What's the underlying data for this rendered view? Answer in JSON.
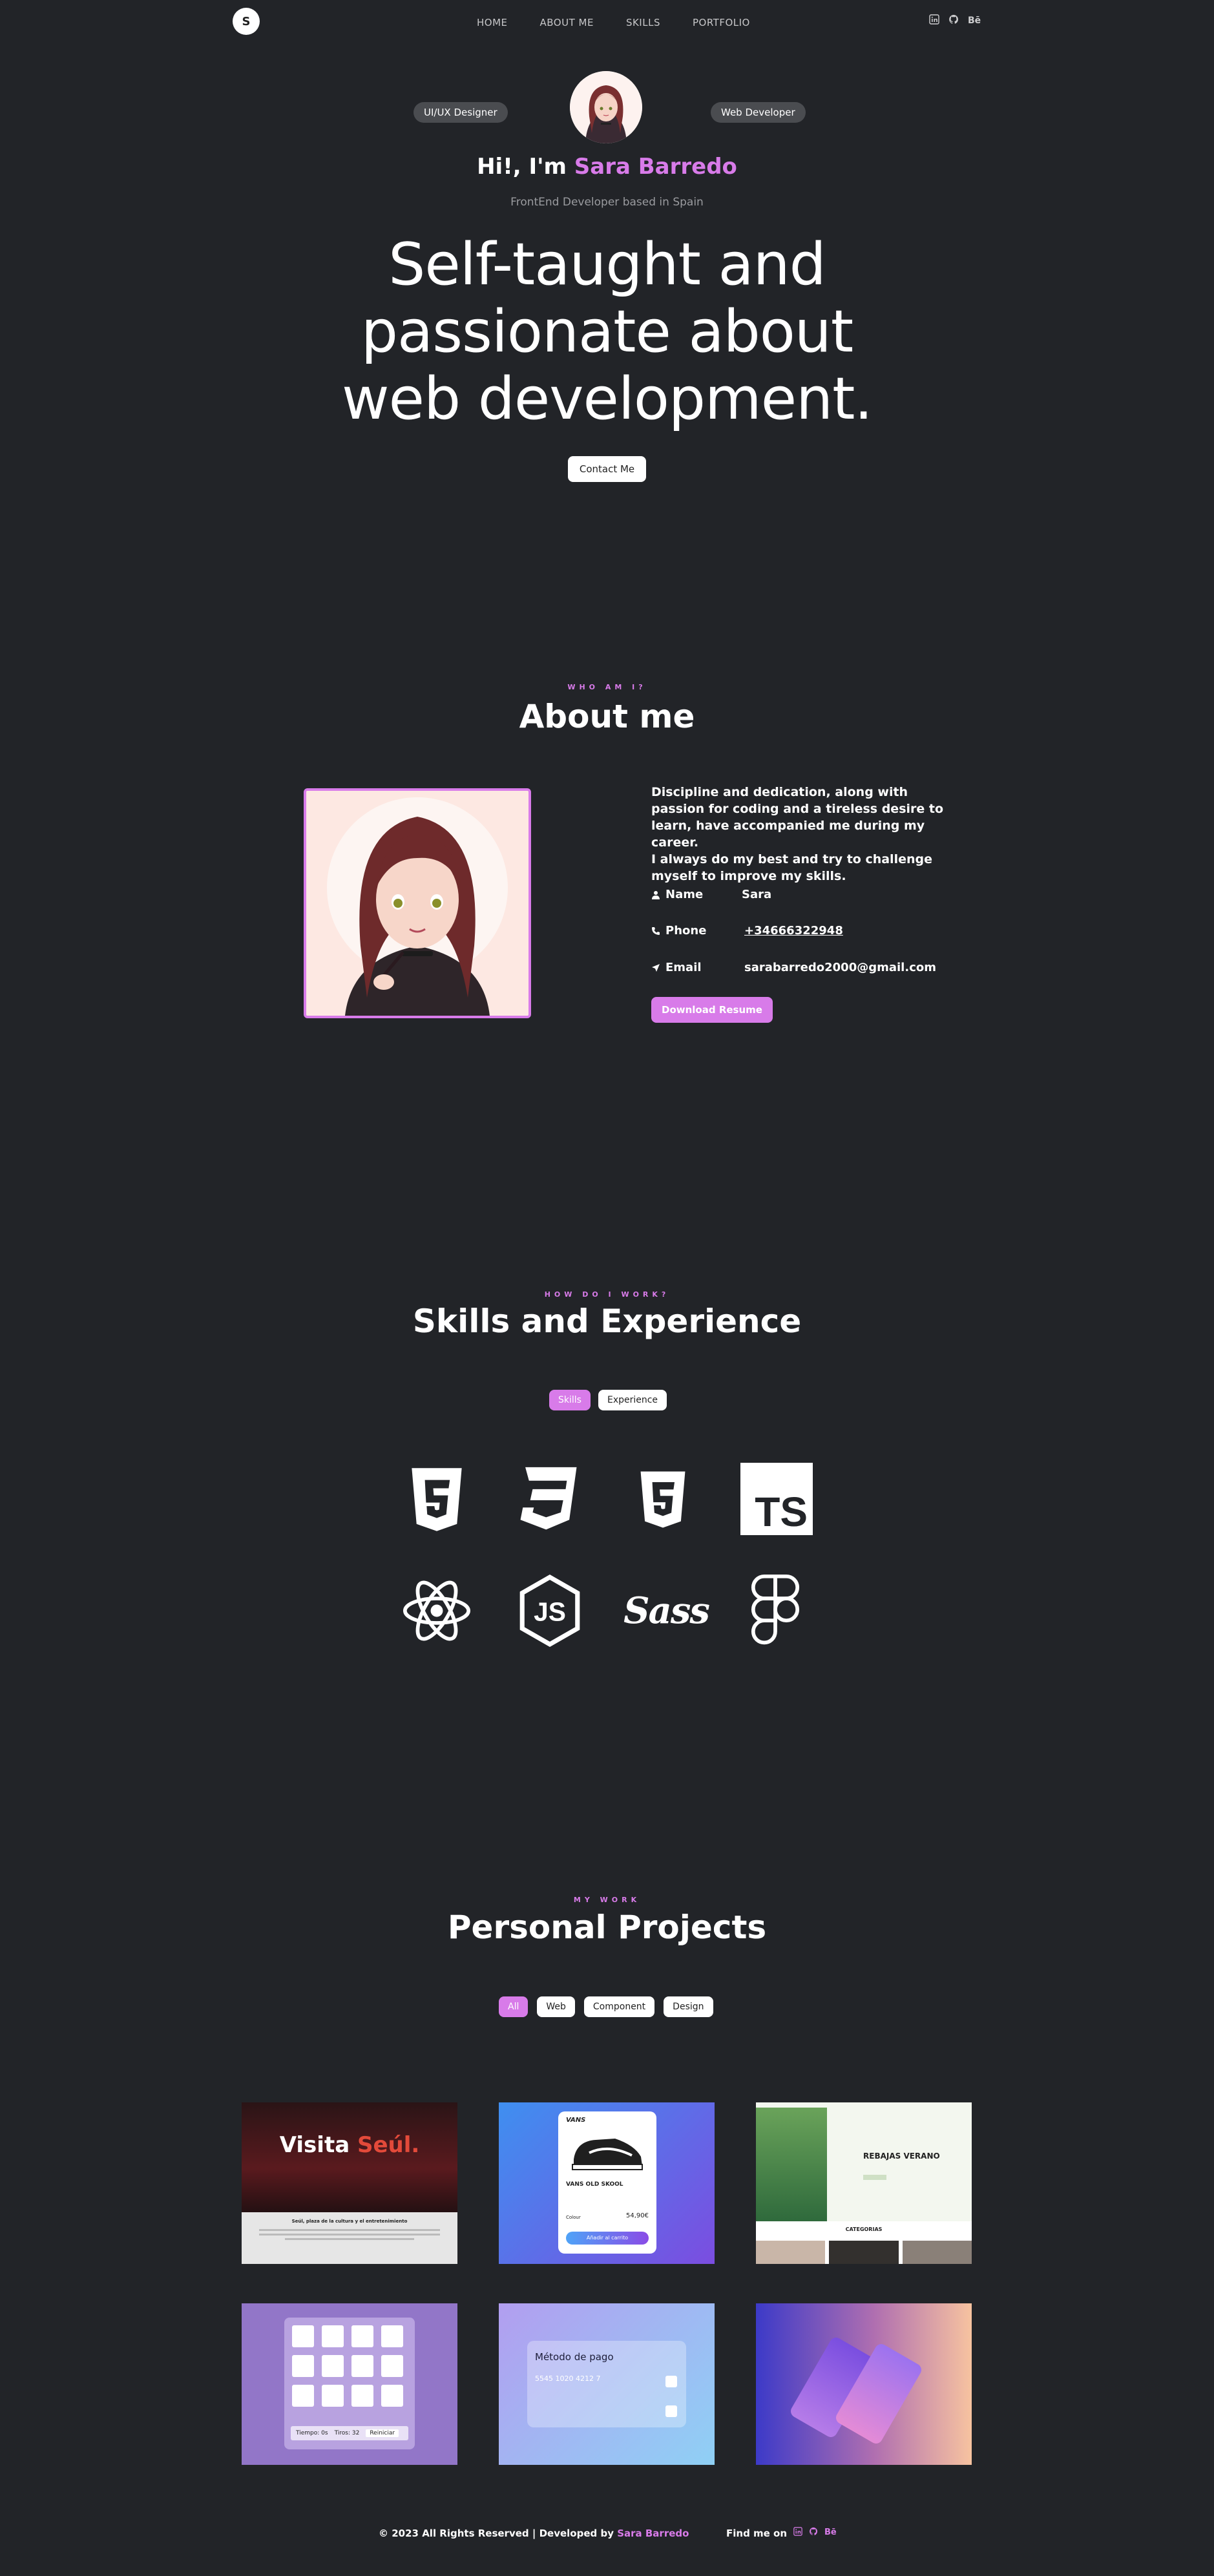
{
  "nav": {
    "logo": "S",
    "links": [
      "HOME",
      "ABOUT ME",
      "SKILLS",
      "PORTFOLIO"
    ],
    "social": {
      "behance": "Bē"
    }
  },
  "hero": {
    "badge_left": "UI/UX Designer",
    "badge_right": "Web Developer",
    "greeting": "Hi!, I'm ",
    "name": "Sara Barredo",
    "subtitle": "FrontEnd Developer based in Spain",
    "headline_1": "Self-taught and",
    "headline_2": "passionate about",
    "headline_3": "web development.",
    "cta": "Contact Me"
  },
  "about": {
    "kicker": "WHO AM I?",
    "title": "About me",
    "text_1": "Discipline and dedication, along with passion for coding and a tireless desire to learn, have accompanied me during my career.",
    "text_2": "I always do my best and try to challenge myself to improve my skills.",
    "name_label": "Name",
    "name_value": "Sara",
    "phone_label": "Phone",
    "phone_value": "+34666322948",
    "email_label": "Email",
    "email_value": "sarabarredo2000@gmail.com",
    "resume": "Download Resume"
  },
  "skills": {
    "kicker": "HOW DO I WORK?",
    "title": "Skills and Experience",
    "tabs": [
      "Skills",
      "Experience"
    ],
    "icons": [
      "html5-icon",
      "css3-icon",
      "html5-icon",
      "typescript-icon",
      "react-icon",
      "nodejs-icon",
      "sass-icon",
      "figma-icon"
    ],
    "ts_text": "TS",
    "sass_text": "Sass"
  },
  "projects": {
    "kicker": "MY WORK",
    "title": "Personal Projects",
    "filters": [
      "All",
      "Web",
      "Component",
      "Design"
    ],
    "p1_title_a": "Visita ",
    "p1_title_b": "Seúl.",
    "p1_sub": "Seúl, plaza de la cultura y el entretenimiento",
    "p2_brand": "VANS",
    "p2_name": "VANS OLD SKOOL",
    "p2_color": "Colour",
    "p2_price": "54,90€",
    "p2_btn": "Añadir al carrito",
    "p3_title": "REBAJAS VERANO",
    "p3_sub": "CATEGORIAS",
    "p4_time": "Tiempo: 0s",
    "p4_shots": "Tiros: 32",
    "p4_btn": "Reiniciar",
    "p5_title": "Método de pago",
    "p5_num": "5545 1020 4212 7"
  },
  "footer": {
    "copy": "© 2023 All Rights Reserved | Developed by ",
    "name": "Sara Barredo",
    "find": "Find me on",
    "behance": "Bē"
  },
  "colors": {
    "accent": "#d87be9",
    "bg": "#222428"
  }
}
